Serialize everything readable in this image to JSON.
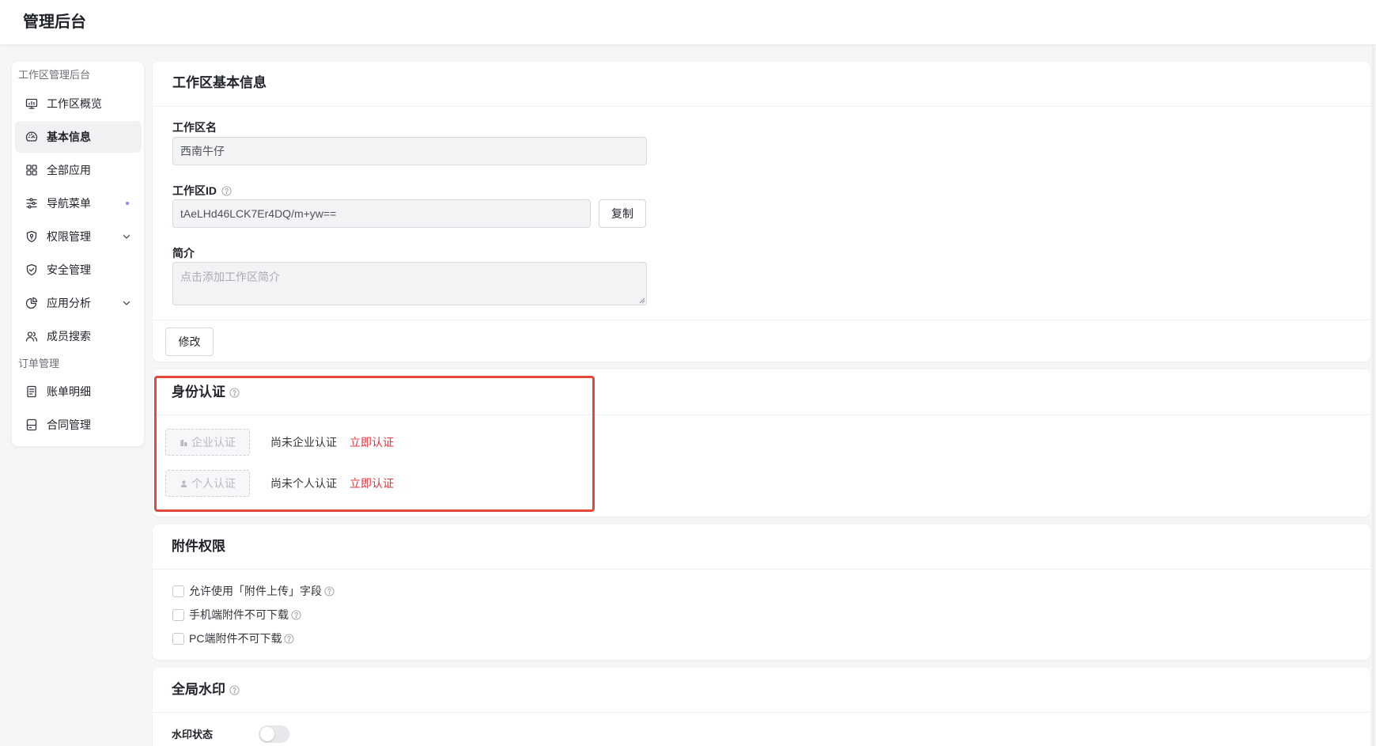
{
  "header": {
    "title": "管理后台"
  },
  "sidebar": {
    "groups": [
      {
        "label": "工作区管理后台",
        "items": [
          {
            "label": "工作区概览",
            "icon": "monitor-icon"
          },
          {
            "label": "基本信息",
            "icon": "dashboard-icon",
            "active": true
          },
          {
            "label": "全部应用",
            "icon": "grid-icon"
          },
          {
            "label": "导航菜单",
            "icon": "sliders-icon",
            "badge_dot": true
          },
          {
            "label": "权限管理",
            "icon": "shield-key-icon",
            "expandable": true
          },
          {
            "label": "安全管理",
            "icon": "shield-check-icon"
          },
          {
            "label": "应用分析",
            "icon": "pie-chart-icon",
            "expandable": true
          },
          {
            "label": "成员搜索",
            "icon": "users-icon"
          }
        ]
      },
      {
        "label": "订单管理",
        "items": [
          {
            "label": "账单明细",
            "icon": "receipt-icon"
          },
          {
            "label": "合同管理",
            "icon": "archive-icon"
          }
        ]
      }
    ]
  },
  "basic_info": {
    "title": "工作区基本信息",
    "name_label": "工作区名",
    "name_value": "西南牛仔",
    "id_label": "工作区ID",
    "id_value": "tAeLHd46LCK7Er4DQ/m+yw==",
    "copy_label": "复制",
    "intro_label": "简介",
    "intro_placeholder": "点击添加工作区简介",
    "edit_label": "修改"
  },
  "identity": {
    "title": "身份认证",
    "rows": [
      {
        "button_label": "企业认证",
        "button_icon": "building-icon",
        "status": "尚未企业认证",
        "action": "立即认证"
      },
      {
        "button_label": "个人认证",
        "button_icon": "user-icon",
        "status": "尚未个人认证",
        "action": "立即认证"
      }
    ]
  },
  "attachments": {
    "title": "附件权限",
    "options": [
      {
        "label": "允许使用「附件上传」字段",
        "checked": false
      },
      {
        "label": "手机端附件不可下载",
        "checked": false
      },
      {
        "label": "PC端附件不可下载",
        "checked": false
      }
    ]
  },
  "watermark": {
    "title": "全局水印",
    "status_label": "水印状态",
    "enabled": false
  },
  "colors": {
    "page_background": "#f5f6f8",
    "accent_red": "#e0393e",
    "highlight_border": "#e5473b",
    "active_item_background": "#f0f1f3",
    "nav_dot": "#8b87f0",
    "toggle_off": "#e6e8eb"
  }
}
